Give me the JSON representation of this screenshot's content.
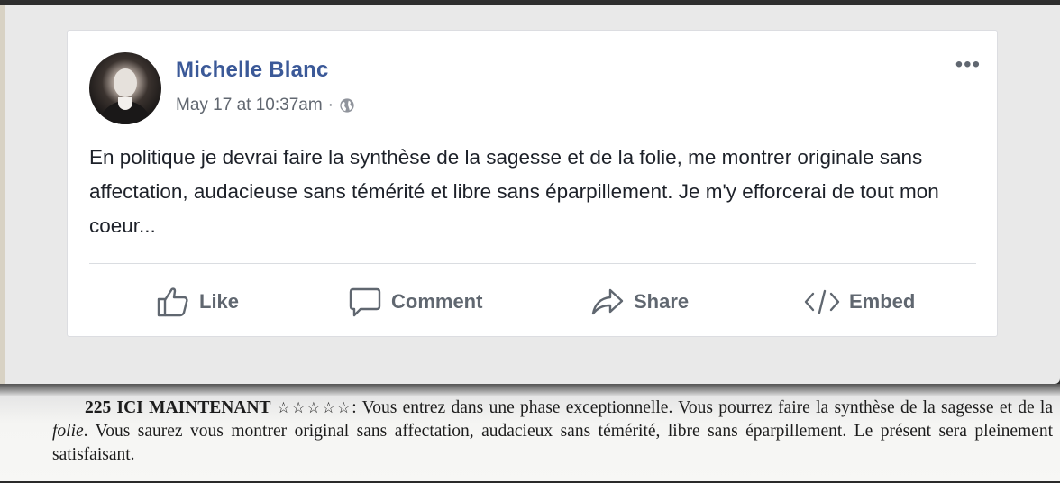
{
  "post": {
    "author": "Michelle Blanc",
    "timestamp": "May 17 at 10:37am",
    "separator": "·",
    "privacy_icon": "globe-icon",
    "more_icon": "•••",
    "text": "En politique je devrai faire la synthèse de la sagesse et de la folie, me montrer originale sans affectation, audacieuse sans témérité et libre sans éparpillement. Je m'y efforcerai de tout mon coeur...",
    "actions": {
      "like": "Like",
      "comment": "Comment",
      "share": "Share",
      "embed": "Embed"
    }
  },
  "book": {
    "title": "225 ICI MAINTENANT",
    "stars": "☆☆☆☆☆",
    "after_stars": ": Vous entrez dans une phase exceptionnelle. Vous pourrez faire la synthèse de la sagesse et de la ",
    "italic_word": "folie",
    "rest": ". Vous saurez vous montrer original sans affectation, audacieux sans témérité, libre sans éparpillement. Le présent sera pleinement satisfaisant."
  },
  "colors": {
    "author_blue": "#3b5998",
    "action_gray": "#606770",
    "text": "#1d2129"
  }
}
